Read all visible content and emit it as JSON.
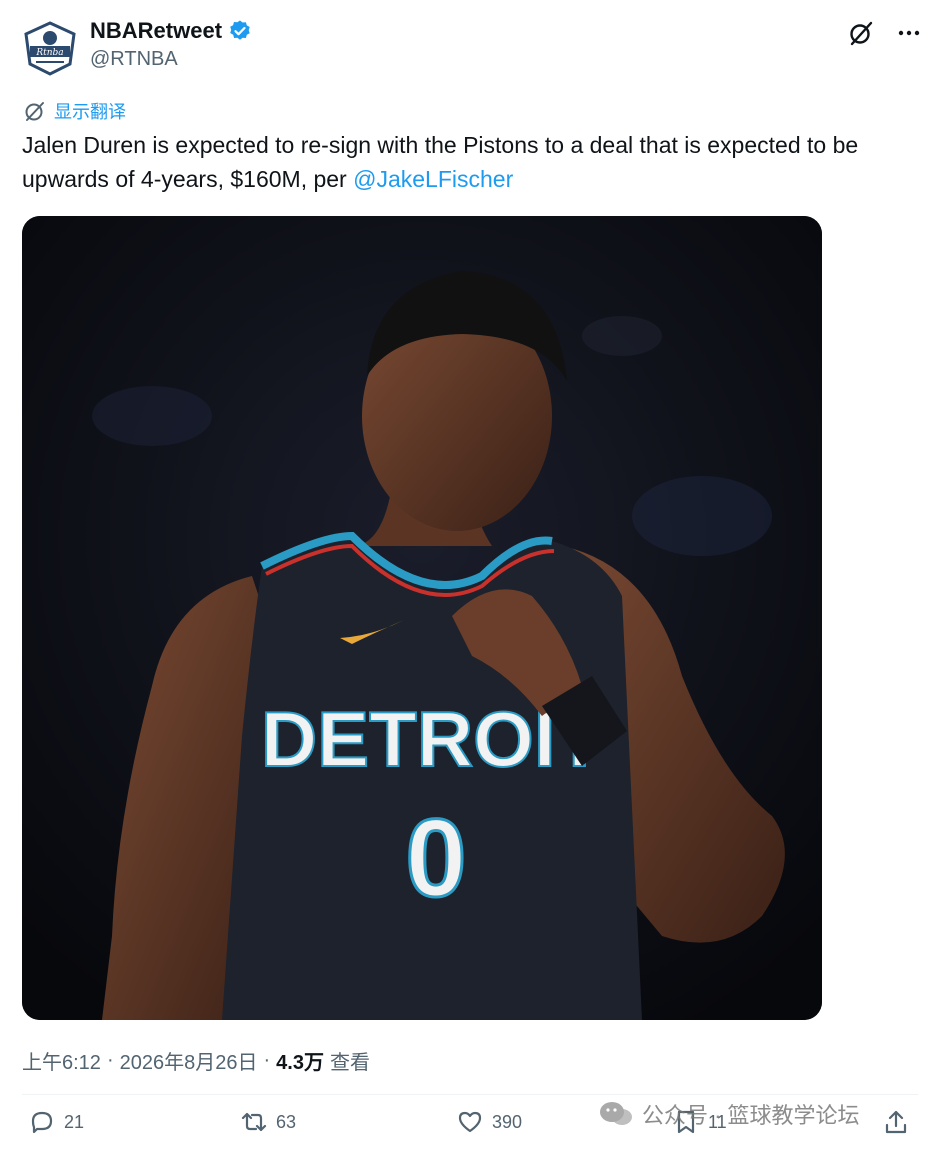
{
  "author": {
    "display_name": "NBARetweet",
    "handle": "@RTNBA",
    "verified": true,
    "avatar_text": "Rtnba"
  },
  "top_actions": [
    {
      "icon": "grok-icon"
    },
    {
      "icon": "more-icon"
    }
  ],
  "translate_label": "显示翻译",
  "tweet": {
    "text": "Jalen Duren is expected to re-sign with the Pistons to a deal that is expected to be upwards of 4-years, $160M, per ",
    "mention": "@JakeLFischer"
  },
  "media": {
    "jersey_text": "DETROIT",
    "jersey_number": "0"
  },
  "meta": {
    "time": "上午6:12",
    "dot1": "·",
    "date": "2026年8月26日",
    "dot2": "·",
    "views": "4.3万",
    "views_label": "查看"
  },
  "actions": {
    "replies": "21",
    "retweets": "63",
    "likes": "390",
    "bookmarks": "11"
  },
  "watermark": {
    "text": "公众号 · 篮球教学论坛"
  },
  "colors": {
    "accent": "#1d9bf0",
    "secondary_text": "#536471",
    "primary_text": "#0f1419"
  }
}
